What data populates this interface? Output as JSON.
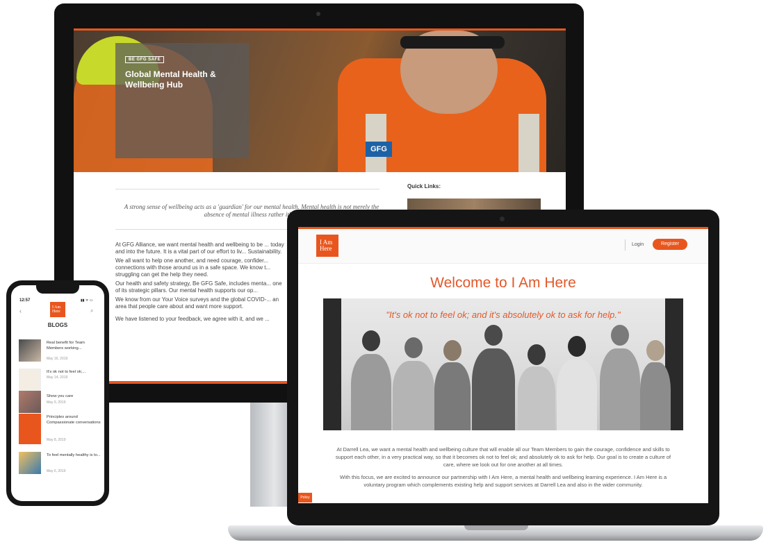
{
  "desktop": {
    "hero": {
      "tag": "BE GFG SAFE",
      "title_line1": "Global Mental Health &",
      "title_line2": "Wellbeing Hub",
      "badge": "GFG"
    },
    "quote": "A strong sense of wellbeing acts as a 'guardian' for our mental health. Mental health is not merely the absence of mental illness rather it's ...",
    "paragraphs": [
      "At GFG Alliance, we want mental health and wellbeing to be ... today and into the future. It is a vital part of our effort to liv... Sustainability.",
      "We all want to help one another, and need courage, confider... connections with those around us in a safe space. We know t... struggling can get the help they need.",
      "Our health and safety strategy, Be GFG Safe, includes menta... one of its strategic pillars. Our mental health supports our op...",
      "We know from our Your Voice surveys and the global COVID-... an area that people care about and want more support.",
      "We have listened to your feedback, we agree with it, and we ..."
    ],
    "quick_links_title": "Quick Links:"
  },
  "laptop": {
    "logo_line1": "I Am",
    "logo_line2": "Here",
    "login_label": "Login",
    "register_label": "Register",
    "welcome": "Welcome to I Am Here",
    "tagline": "\"It's ok not to feel ok; and it's absolutely ok to ask for help.\"",
    "body_p1": "At Darrell Lea, we want a mental health and wellbeing culture that will enable all our Team Members to gain the courage, confidence and skills to support each other, in a very practical way, so that it becomes ok not to feel ok; and absolutely ok to ask for help. Our goal is to create a culture of care, where we look out for one another at all times.",
    "body_p2": "With this focus, we are excited to announce our partnership with I Am Here, a mental health and wellbeing learning experience. I Am Here is a voluntary program which complements existing help and support services at Darrell Lea and also in the wider community.",
    "policy_label": "Policy"
  },
  "phone": {
    "time": "12:57",
    "status_icons": "▮▮ ᯤ ▭",
    "logo_line1": "I Am",
    "logo_line2": "Here",
    "heading": "BLOGS",
    "blogs": [
      {
        "title": "Real benefit for Team Members working...",
        "date": "May 16, 2019"
      },
      {
        "title": "It's ok not to feel ok;...",
        "date": "May 14, 2019"
      },
      {
        "title": "Show you care",
        "date": "May 9, 2019"
      },
      {
        "title": "Principles around Compassionate conversations",
        "date": "May 8, 2019"
      },
      {
        "title": "To feel mentally healthy is to...",
        "date": "May 6, 2019"
      }
    ]
  },
  "colors": {
    "accent": "#e8561e",
    "device_frame": "#151515"
  }
}
